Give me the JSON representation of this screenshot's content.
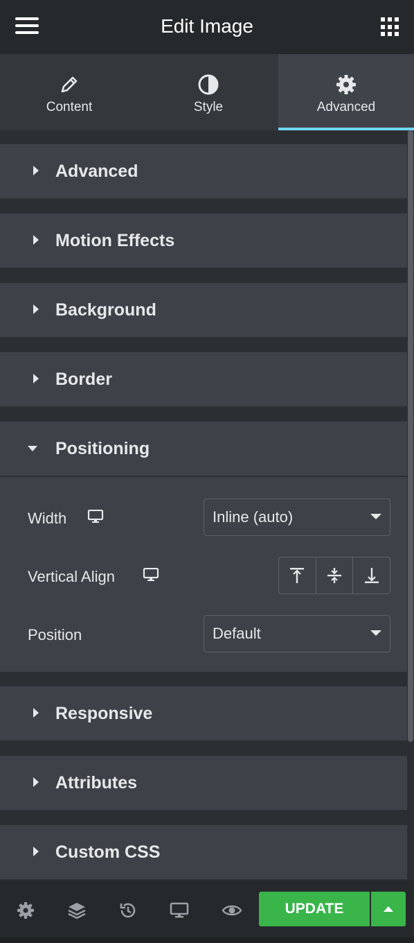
{
  "header": {
    "title": "Edit Image",
    "menu_icon": "hamburger-icon",
    "apps_icon": "grid-icon"
  },
  "tabs": [
    {
      "label": "Content",
      "icon": "pencil-icon",
      "active": false
    },
    {
      "label": "Style",
      "icon": "half-circle-icon",
      "active": false
    },
    {
      "label": "Advanced",
      "icon": "gear-icon",
      "active": true
    }
  ],
  "sections": {
    "advanced": "Advanced",
    "motion_effects": "Motion Effects",
    "background": "Background",
    "border": "Border",
    "positioning": "Positioning",
    "responsive": "Responsive",
    "attributes": "Attributes",
    "custom_css": "Custom CSS"
  },
  "positioning": {
    "width_label": "Width",
    "width_value": "Inline (auto)",
    "vertical_align_label": "Vertical Align",
    "vertical_align_options": [
      "align-top-icon",
      "align-middle-icon",
      "align-bottom-icon"
    ],
    "position_label": "Position",
    "position_value": "Default"
  },
  "footer": {
    "icons": [
      "settings-icon",
      "layers-icon",
      "history-icon",
      "responsive-icon",
      "preview-icon"
    ],
    "update_label": "UPDATE"
  },
  "colors": {
    "accent_tab": "#71d7f7",
    "update_green": "#39b54a"
  }
}
